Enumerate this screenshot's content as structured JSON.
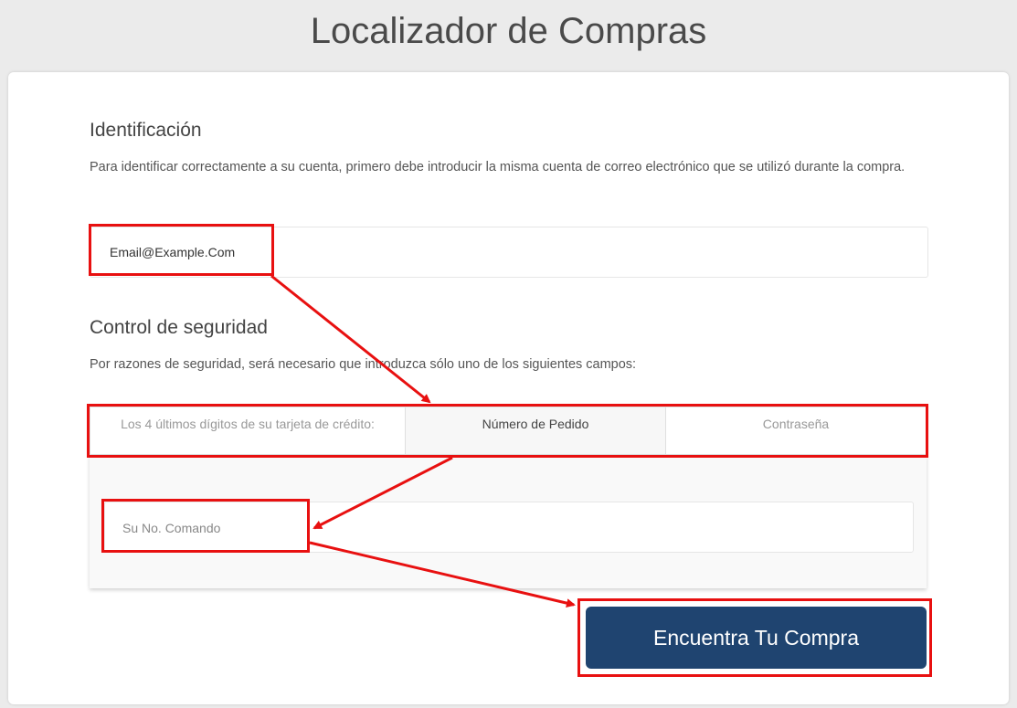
{
  "page": {
    "title": "Localizador de Compras"
  },
  "identification": {
    "heading": "Identificación",
    "description": "Para identificar correctamente a su cuenta, primero debe introducir la misma cuenta de correo electrónico que se utilizó durante la compra.",
    "email_placeholder": "Email@Example.Com"
  },
  "security": {
    "heading": "Control de seguridad",
    "description": "Por razones de seguridad, será necesario que introduzca sólo uno de los siguientes campos:",
    "tabs": [
      {
        "label": "Los 4 últimos dígitos de su tarjeta de crédito:",
        "active": false
      },
      {
        "label": "Número de Pedido",
        "active": true
      },
      {
        "label": "Contraseña",
        "active": false
      }
    ],
    "order_placeholder": "Su No. Comando"
  },
  "submit": {
    "label": "Encuentra Tu Compra"
  },
  "colors": {
    "annotation": "#e81010",
    "button": "#1f4470",
    "background": "#ebebeb"
  }
}
